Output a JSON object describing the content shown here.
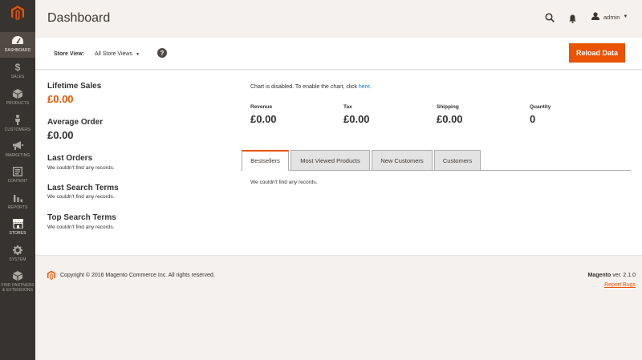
{
  "sidebar": {
    "items": [
      {
        "label": "Dashboard",
        "icon": "dashboard-icon"
      },
      {
        "label": "Sales",
        "icon": "dollar-icon"
      },
      {
        "label": "Products",
        "icon": "box-icon"
      },
      {
        "label": "Customers",
        "icon": "person-icon"
      },
      {
        "label": "Marketing",
        "icon": "megaphone-icon"
      },
      {
        "label": "Content",
        "icon": "content-icon"
      },
      {
        "label": "Reports",
        "icon": "bar-chart-icon"
      },
      {
        "label": "Stores",
        "icon": "store-icon"
      },
      {
        "label": "System",
        "icon": "gear-icon"
      },
      {
        "label": "Find Partners\n& Extensions",
        "icon": "extensions-icon"
      }
    ],
    "active_index": 0
  },
  "header": {
    "title": "Dashboard",
    "user": "admin"
  },
  "store_bar": {
    "label": "Store View:",
    "selected": "All Store Views",
    "reload_button": "Reload Data"
  },
  "left_stats": {
    "lifetime_sales_title": "Lifetime Sales",
    "lifetime_sales_value": "£0.00",
    "average_order_title": "Average Order",
    "average_order_value": "£0.00",
    "last_orders_title": "Last Orders",
    "last_orders_note": "We couldn't find any records.",
    "last_search_title": "Last Search Terms",
    "last_search_note": "We couldn't find any records.",
    "top_search_title": "Top Search Terms",
    "top_search_note": "We couldn't find any records."
  },
  "chart": {
    "message": "Chart is disabled. To enable the chart, click ",
    "link": "here",
    "suffix": "."
  },
  "totals": [
    {
      "label": "Revenue",
      "value": "£0.00"
    },
    {
      "label": "Tax",
      "value": "£0.00"
    },
    {
      "label": "Shipping",
      "value": "£0.00"
    },
    {
      "label": "Quantity",
      "value": "0"
    }
  ],
  "tabs": {
    "items": [
      "Bestsellers",
      "Most Viewed Products",
      "New Customers",
      "Customers"
    ],
    "active_index": 0,
    "empty_note": "We couldn't find any records."
  },
  "footer": {
    "copyright": "Copyright © 2016 Magento Commerce Inc. All rights reserved.",
    "brand": "Magento",
    "version": " ver. 2.1.0",
    "report_bugs": "Report Bugs"
  },
  "colors": {
    "accent": "#eb5202",
    "sidebar_bg": "#373330",
    "link": "#007bdb"
  }
}
